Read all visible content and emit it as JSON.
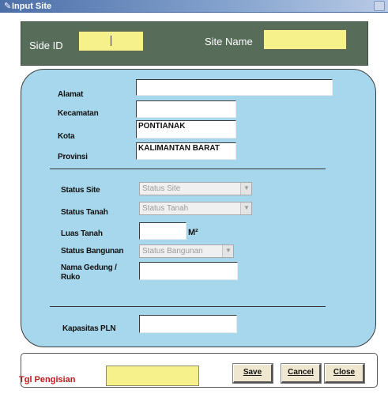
{
  "window": {
    "title": "Input Site",
    "icon": "pencil-icon"
  },
  "header": {
    "site_id_label": "Side ID",
    "site_id_value": "",
    "site_name_label": "Site Name",
    "site_name_value": "",
    "panel_color": "#576d5a",
    "input_color": "#f6f18a"
  },
  "form": {
    "panel_color": "#a7d7ec",
    "alamat_label": "Alamat",
    "alamat_value": "",
    "kecamatan_label": "Kecamatan",
    "kecamatan_value": "",
    "kota_label": "Kota",
    "kota_value": "PONTIANAK",
    "provinsi_label": "Provinsi",
    "provinsi_value": "KALIMANTAN BARAT",
    "status_site_label": "Status Site",
    "status_site_value": "Status Site",
    "status_tanah_label": "Status Tanah",
    "status_tanah_value": "Status Tanah",
    "luas_tanah_label": "Luas Tanah",
    "luas_tanah_value": "",
    "luas_unit": "M²",
    "status_bangunan_label": "Status Bangunan",
    "status_bangunan_value": "Status Bangunan",
    "nama_gedung_label_line1": "Nama Gedung /",
    "nama_gedung_label_line2": "Ruko",
    "nama_gedung_value": "",
    "kapasitas_pln_label": "Kapasitas PLN",
    "kapasitas_pln_value": ""
  },
  "footer": {
    "tgl_label": "Tgl Pengisian",
    "tgl_value": "",
    "tgl_label_color": "#c0171a",
    "save_label": "Save",
    "cancel_label": "Cancel",
    "close_label": "Close"
  }
}
